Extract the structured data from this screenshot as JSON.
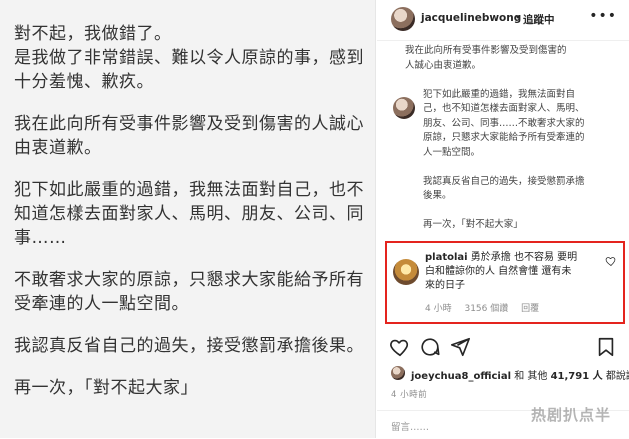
{
  "post": {
    "lines": [
      "對不起，我做錯了。",
      "是我做了非常錯誤、難以令人原諒的事，感到",
      "十分羞愧、歉疚。",
      "",
      "我在此向所有受事件影響及受到傷害的人誠心",
      "由衷道歉。",
      "",
      "犯下如此嚴重的過錯，我無法面對自己，也不",
      "知道怎樣去面對家人、馬明、朋友、公司、同",
      "事……",
      "",
      "不敢奢求大家的原諒，只懇求大家能給予所有",
      "受牽連的人一點空間。",
      "",
      "我認真反省自己的過失，接受懲罰承擔後果。",
      "",
      "再一次，「對不起大家」"
    ]
  },
  "header": {
    "username": "jacquelinebwong",
    "separator": "•",
    "follow_label": "追蹤中",
    "more_icon": "more-horizontal-icon"
  },
  "caption": {
    "lines": [
      {
        "text": "我在此向所有受事件影響及受到傷害的",
        "row": 0
      },
      {
        "text": "人誠心由衷道歉。",
        "row": 1
      },
      {
        "text": "犯下如此嚴重的過錯，我無法面對自",
        "row": 3
      },
      {
        "text": "己，也不知道怎樣去面對家人、馬明、",
        "row": 4
      },
      {
        "text": "朋友、公司、同事……不敢奢求大家的",
        "row": 5
      },
      {
        "text": "原諒，只懇求大家能給予所有受牽連的",
        "row": 6
      },
      {
        "text": "人一點空間。",
        "row": 7
      },
      {
        "text": "我認真反省自己的過失，接受懲罰承擔",
        "row": 9
      },
      {
        "text": "後果。",
        "row": 10
      },
      {
        "text": "再一次，「對不起大家」",
        "row": 12
      }
    ]
  },
  "highlight_comment": {
    "username": "platolai",
    "line1": "勇於承擔 也不容易 要明",
    "line2": "白和體諒你的人 自然會懂 還有未",
    "line3": "來的日子",
    "time": "4 小時",
    "likes": "3156 個讚",
    "reply": "回覆",
    "accent_color": "#e4241e"
  },
  "actions": {
    "icons": [
      "heart-icon",
      "comment-icon",
      "share-icon",
      "bookmark-icon"
    ]
  },
  "likes": {
    "prefix": "joeychua8_official",
    "middle": " 和 其他 ",
    "count": "41,791 人",
    "suffix": " 都說讚"
  },
  "timestamp": "4 小時前",
  "comment_input": {
    "placeholder": "留言……"
  },
  "watermark": "热剧扒点半"
}
